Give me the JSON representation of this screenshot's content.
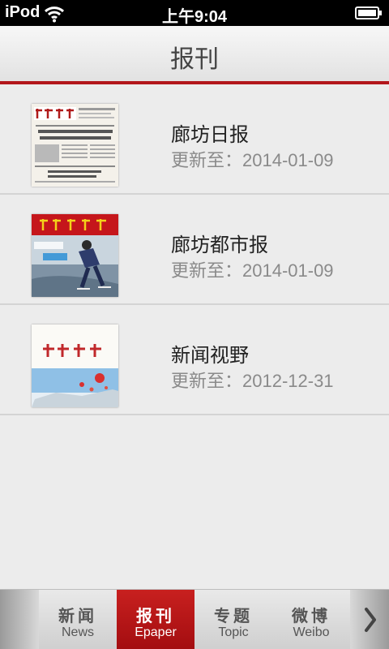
{
  "status_bar": {
    "carrier": "iPod",
    "time": "上午9:04"
  },
  "header": {
    "title": "报刊"
  },
  "papers": [
    {
      "title": "廊坊日报",
      "updated": "更新至：2014-01-09",
      "thumb_icon": "newspaper-front-page-icon"
    },
    {
      "title": "廊坊都市报",
      "updated": "更新至：2014-01-09",
      "thumb_icon": "newspaper-cover-skater-icon"
    },
    {
      "title": "新闻视野",
      "updated": "更新至：2012-12-31",
      "thumb_icon": "magazine-cover-balloons-icon"
    }
  ],
  "tabs": [
    {
      "cn": "新闻",
      "en": "News",
      "active": false
    },
    {
      "cn": "报刊",
      "en": "Epaper",
      "active": true
    },
    {
      "cn": "专题",
      "en": "Topic",
      "active": false
    },
    {
      "cn": "微博",
      "en": "Weibo",
      "active": false
    }
  ],
  "colors": {
    "accent": "#b3161b",
    "active_tab": "#b8161a",
    "background": "#ececec"
  }
}
